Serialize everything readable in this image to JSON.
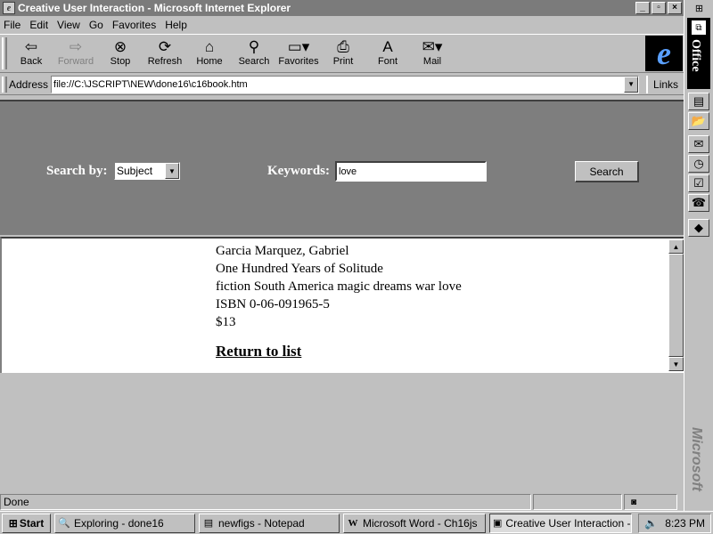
{
  "window": {
    "title": "Creative User Interaction - Microsoft Internet Explorer",
    "controls": {
      "minimize": "_",
      "maximize": "▫",
      "close": "×"
    }
  },
  "menu": [
    "File",
    "Edit",
    "View",
    "Go",
    "Favorites",
    "Help"
  ],
  "toolbar": {
    "back": "Back",
    "forward": "Forward",
    "stop": "Stop",
    "refresh": "Refresh",
    "home": "Home",
    "search": "Search",
    "favorites": "Favorites",
    "print": "Print",
    "font": "Font",
    "mail": "Mail"
  },
  "address": {
    "label": "Address",
    "url": "file://C:\\JSCRIPT\\NEW\\done16\\c16book.htm",
    "links": "Links"
  },
  "search_form": {
    "search_by_label": "Search by:",
    "search_by_value": "Subject",
    "keywords_label": "Keywords:",
    "keywords_value": "love",
    "search_button": "Search"
  },
  "book": {
    "author": "Garcia Marquez, Gabriel",
    "title": "One Hundred Years of Solitude",
    "keywords": "fiction South America magic dreams war love",
    "isbn": "ISBN 0-06-091965-5",
    "price": "$13",
    "return_link": "Return to list"
  },
  "status": {
    "text": "Done"
  },
  "office_bar": {
    "label": "Office",
    "brand": "Microsoft"
  },
  "taskbar": {
    "start": "Start",
    "tasks": [
      {
        "label": "Exploring - done16",
        "active": false
      },
      {
        "label": "newfigs - Notepad",
        "active": false
      },
      {
        "label": "Microsoft Word - Ch16js",
        "active": false
      },
      {
        "label": "Creative User Interaction - ...",
        "active": true
      }
    ],
    "clock": "8:23 PM"
  }
}
